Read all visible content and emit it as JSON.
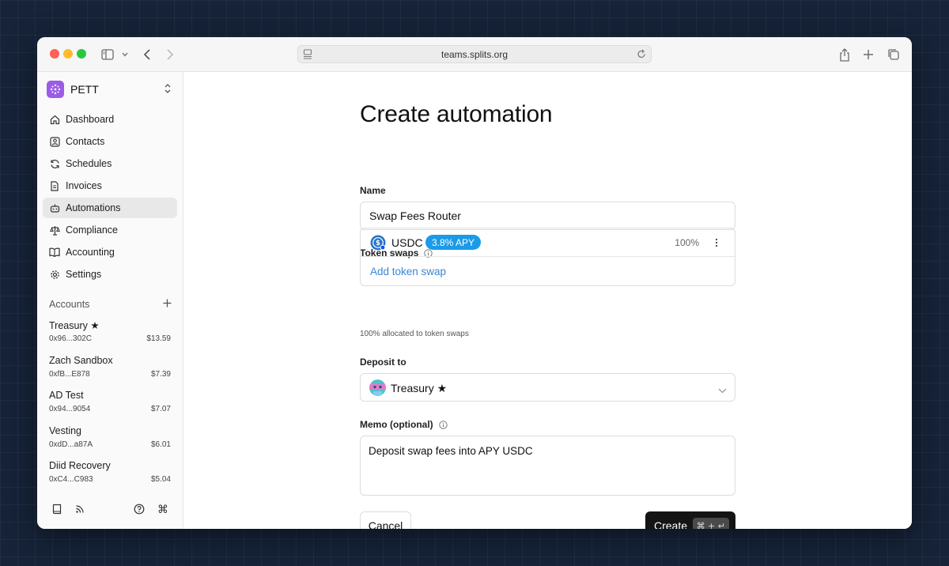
{
  "browser": {
    "url": "teams.splits.org"
  },
  "sidebar": {
    "org_name": "PETT",
    "nav": [
      {
        "label": "Dashboard",
        "icon": "home-icon"
      },
      {
        "label": "Contacts",
        "icon": "contacts-icon"
      },
      {
        "label": "Schedules",
        "icon": "refresh-icon"
      },
      {
        "label": "Invoices",
        "icon": "document-icon"
      },
      {
        "label": "Automations",
        "icon": "robot-icon",
        "active": true
      },
      {
        "label": "Compliance",
        "icon": "scale-icon"
      },
      {
        "label": "Accounting",
        "icon": "book-open-icon"
      },
      {
        "label": "Settings",
        "icon": "gear-icon"
      }
    ],
    "accounts_heading": "Accounts",
    "accounts": [
      {
        "name": "Treasury ★",
        "address": "0x96...302C",
        "balance": "$13.59"
      },
      {
        "name": "Zach Sandbox",
        "address": "0xfB...E878",
        "balance": "$7.39"
      },
      {
        "name": "AD Test",
        "address": "0x94...9054",
        "balance": "$7.07"
      },
      {
        "name": "Vesting",
        "address": "0xdD...a87A",
        "balance": "$6.01"
      },
      {
        "name": "Diid Recovery",
        "address": "0xC4...C983",
        "balance": "$5.04"
      }
    ]
  },
  "form": {
    "title": "Create automation",
    "name_label": "Name",
    "name_value": "Swap Fees Router",
    "swaps_label": "Token swaps",
    "swap": {
      "token": "USDC",
      "apy": "3.8% APY",
      "percent": "100%"
    },
    "add_swap_label": "Add token swap",
    "helper_text": "100% allocated to token swaps",
    "deposit_label": "Deposit to",
    "deposit_value": "Treasury ★",
    "memo_label": "Memo (optional)",
    "memo_value": "Deposit swap fees into APY USDC",
    "cancel_label": "Cancel",
    "create_label": "Create",
    "create_shortcut": "⌘ + ↵"
  },
  "colors": {
    "accent_link": "#3d86d6",
    "apy_badge": "#1a9be8",
    "org_logo": "#9b5de5",
    "create_button": "#141414"
  }
}
